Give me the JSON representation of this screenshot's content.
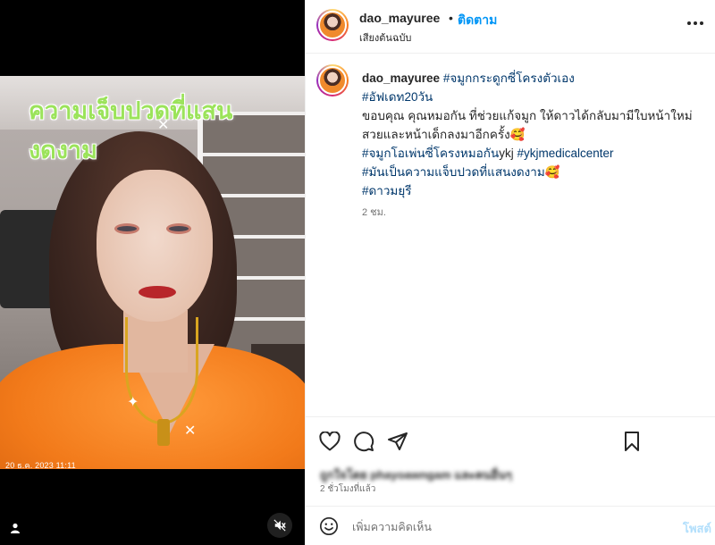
{
  "media": {
    "overlay_text": "ความเจ็บปวดที่แสนงดงาม",
    "timestamp": "20 ธ.ค. 2023 11:11",
    "icons": {
      "user_tag": "user-icon",
      "mute": "muted-speaker-icon"
    }
  },
  "header": {
    "username": "dao_mayuree",
    "separator": "•",
    "follow_label": "ติดตาม",
    "audio_label": "เสียงต้นฉบับ",
    "more_icon": "more-horizontal-icon"
  },
  "caption": {
    "username": "dao_mayuree",
    "tag_title": "#จมูกกระดูกซี่โครงตัวเอง",
    "tag_update": "#อัฟเดท20วัน",
    "text_1": "ขอบคุณ คุณหมอกัน ที่ช่วยแก้จมูก ให้ดาวได้กลับมามีใบหน้าใหม่ สวยและหน้าเด็กลงมาอีกครั้ง🥰",
    "tag_open": "#จมูกโอเพ่นซี่โครงหมอกัน",
    "tag_ykj": "ykj",
    "tag_center": "#ykjmedicalcenter",
    "tag_pain": "#มันเป็นความแจ็บปวดที่แสนงดงาม",
    "emoji_2": "🥰",
    "tag_name": "#ดาวมยุรี",
    "time": "2 ชม."
  },
  "actions": {
    "icons": [
      "heart-icon",
      "comment-icon",
      "share-icon",
      "bookmark-icon"
    ],
    "likes_text": "ถูกใจโดย phayoawngam และคนอื่นๆ",
    "post_time": "2 ชั่วโมงที่แล้ว"
  },
  "comment": {
    "placeholder": "เพิ่มความคิดเห็น",
    "post_label": "โพสต์",
    "emoji_icon": "smiley-icon"
  },
  "colors": {
    "accent": "#0095f6",
    "tag": "#00376b",
    "overlay_text": "#9be35a",
    "post_button_disabled": "#b2dffc"
  }
}
